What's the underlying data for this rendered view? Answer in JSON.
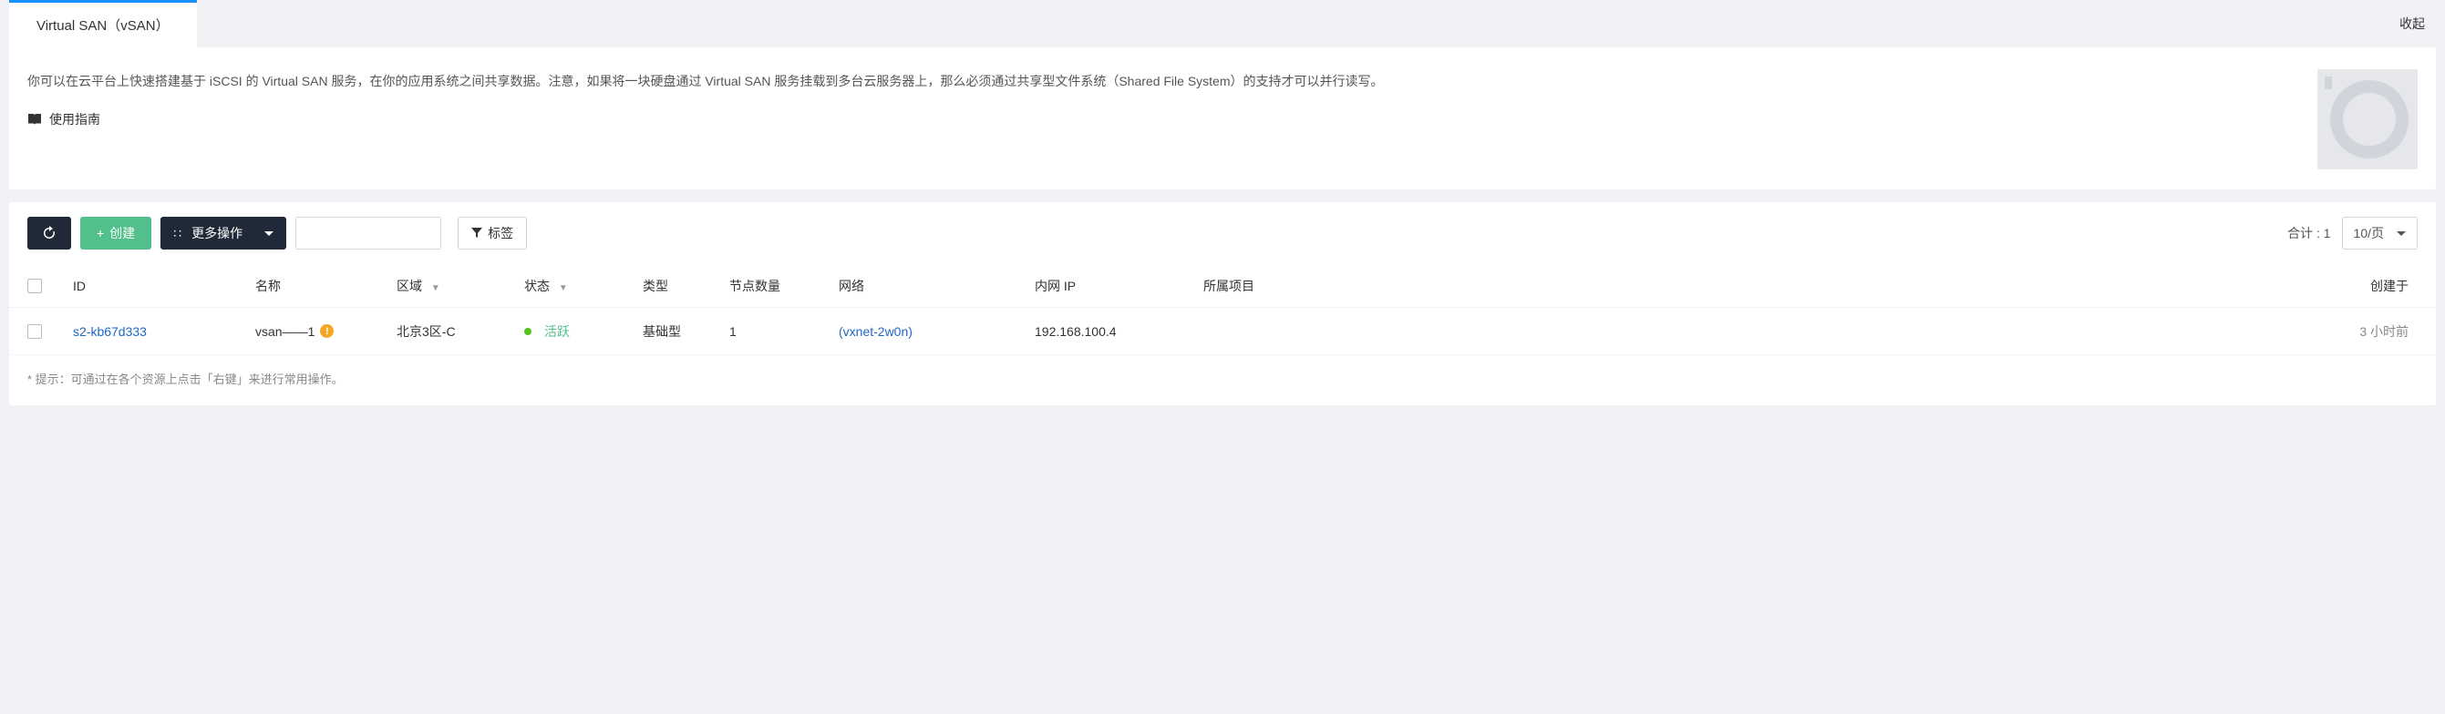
{
  "header": {
    "tab_title": "Virtual SAN（vSAN）",
    "collapse": "收起"
  },
  "info": {
    "description": "你可以在云平台上快速搭建基于 iSCSI 的 Virtual SAN 服务，在你的应用系统之间共享数据。注意，如果将一块硬盘通过 Virtual SAN 服务挂载到多台云服务器上，那么必须通过共享型文件系统（Shared File System）的支持才可以并行读写。",
    "guide_label": "使用指南"
  },
  "toolbar": {
    "create_label": "创建",
    "more_label": "更多操作",
    "tag_label": "标签",
    "total_prefix": "合计 : ",
    "total_count": "1",
    "page_size": "10/页"
  },
  "table": {
    "headers": {
      "id": "ID",
      "name": "名称",
      "region": "区域",
      "status": "状态",
      "type": "类型",
      "nodes": "节点数量",
      "network": "网络",
      "ip": "内网 IP",
      "project": "所属项目",
      "created": "创建于"
    },
    "rows": [
      {
        "id": "s2-kb67d333",
        "name": "vsan——1",
        "region": "北京3区-C",
        "status": "活跃",
        "type": "基础型",
        "nodes": "1",
        "network": "(vxnet-2w0n)",
        "ip": "192.168.100.4",
        "project": "",
        "created": "3 小时前"
      }
    ]
  },
  "hint": "* 提示：可通过在各个资源上点击「右键」来进行常用操作。"
}
